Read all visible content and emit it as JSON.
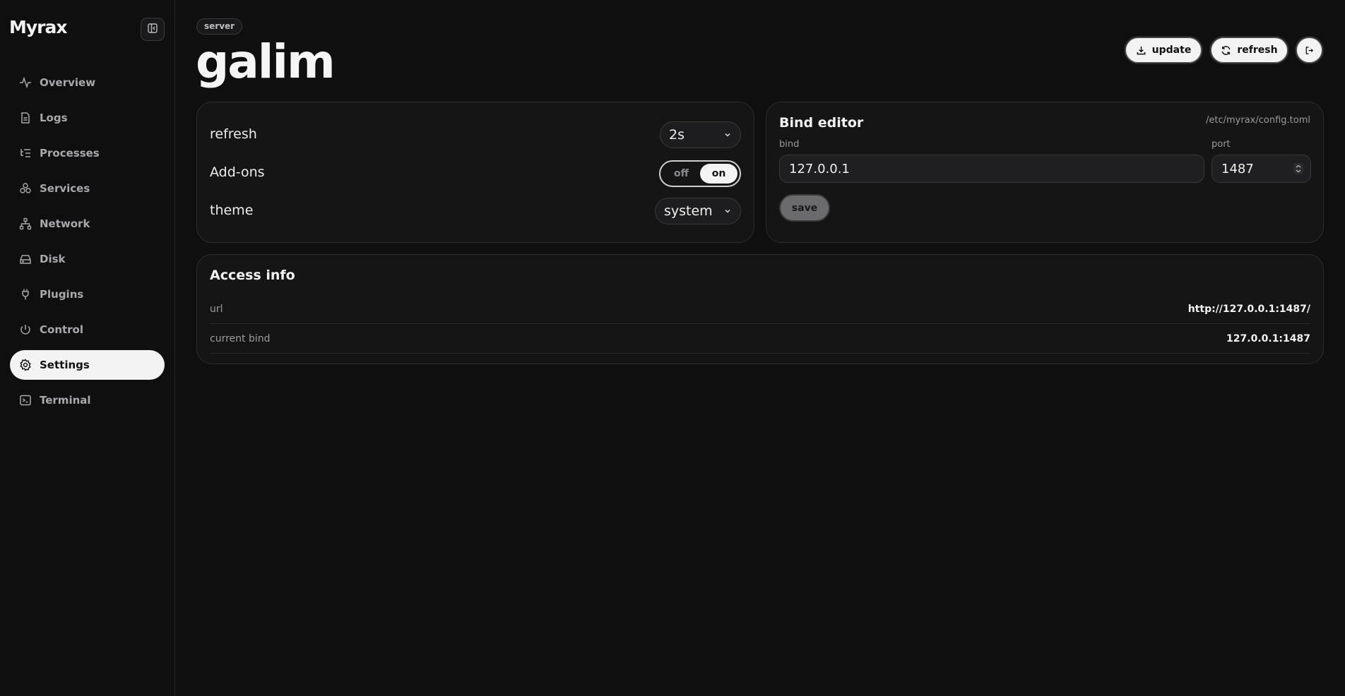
{
  "app": {
    "logo": "Myrax"
  },
  "sidebar": {
    "items": [
      {
        "label": "Overview",
        "icon": "activity-icon"
      },
      {
        "label": "Logs",
        "icon": "file-icon"
      },
      {
        "label": "Processes",
        "icon": "list-tree-icon"
      },
      {
        "label": "Services",
        "icon": "boxes-icon"
      },
      {
        "label": "Network",
        "icon": "network-icon"
      },
      {
        "label": "Disk",
        "icon": "hard-drive-icon"
      },
      {
        "label": "Plugins",
        "icon": "plug-icon"
      },
      {
        "label": "Control",
        "icon": "power-icon"
      },
      {
        "label": "Settings",
        "icon": "gear-icon",
        "active": true
      },
      {
        "label": "Terminal",
        "icon": "terminal-icon"
      }
    ]
  },
  "header": {
    "badge": "server",
    "title": "galim",
    "update_label": "update",
    "refresh_label": "refresh"
  },
  "settings": {
    "refresh_label": "refresh",
    "refresh_value": "2s",
    "addons_label": "Add-ons",
    "addons_off": "off",
    "addons_on": "on",
    "addons_state": "on",
    "theme_label": "theme",
    "theme_value": "system"
  },
  "bind_editor": {
    "title": "Bind editor",
    "path": "/etc/myrax/config.toml",
    "bind_label": "bind",
    "bind_value": "127.0.0.1",
    "port_label": "port",
    "port_value": "1487",
    "save_label": "save"
  },
  "access_info": {
    "title": "Access info",
    "rows": [
      {
        "key": "url",
        "value": "http://127.0.0.1:1487/"
      },
      {
        "key": "current bind",
        "value": "127.0.0.1:1487"
      }
    ]
  },
  "colors": {
    "background": "#0f0f10",
    "card": "#151516",
    "active": "#f3f3f3"
  }
}
